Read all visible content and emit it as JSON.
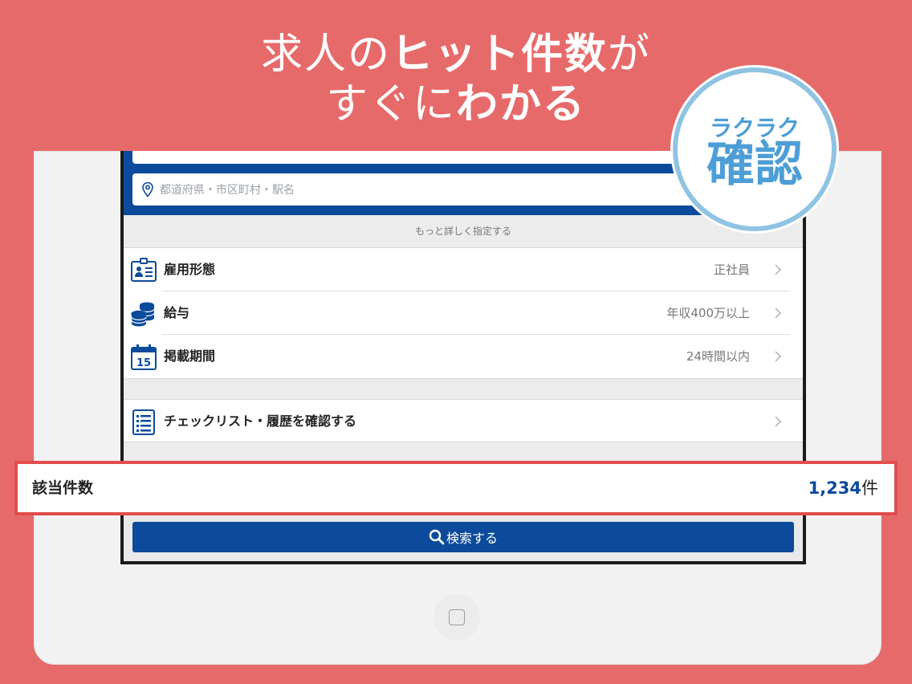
{
  "promo": {
    "headline_line1_prefix": "求人の",
    "headline_line1_bold": "ヒット件数",
    "headline_line1_suffix": "が",
    "headline_line2_prefix": "すぐに",
    "headline_line2_bold": "わかる",
    "badge_small": "ラクラク",
    "badge_big": "確認"
  },
  "search": {
    "location_placeholder": "都道府県・市区町村・駅名",
    "more_options": "もっと詳しく指定する"
  },
  "filters": [
    {
      "icon": "employee-card-icon",
      "label": "雇用形態",
      "value": "正社員"
    },
    {
      "icon": "coins-icon",
      "label": "給与",
      "value": "年収400万以上"
    },
    {
      "icon": "calendar-15-icon",
      "label": "掲載期間",
      "value": "24時間以内"
    }
  ],
  "checklist": {
    "icon": "checklist-icon",
    "label": "チェックリスト・履歴を確認する"
  },
  "results": {
    "label": "該当件数",
    "count": "1,234",
    "unit": "件"
  },
  "search_button": {
    "icon": "search-icon",
    "label": "検索する"
  },
  "colors": {
    "background": "#e76a6a",
    "brand_blue": "#0c4a9b",
    "badge_blue": "#4d9ed6",
    "highlight_red": "#e24c4c"
  }
}
